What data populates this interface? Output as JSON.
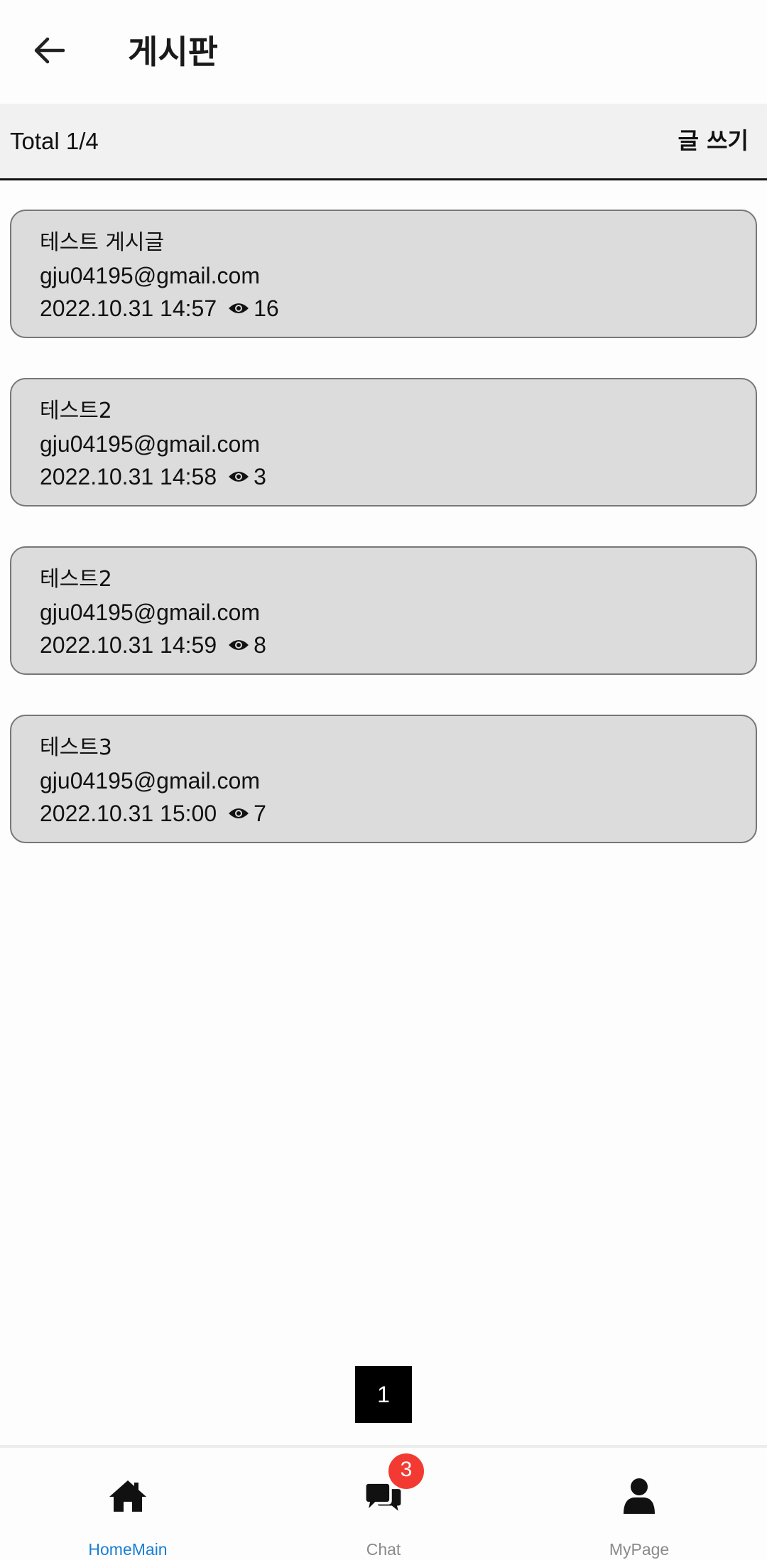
{
  "header": {
    "title": "게시판"
  },
  "subheader": {
    "total": "Total 1/4",
    "write_label": "글 쓰기"
  },
  "posts": [
    {
      "title": "테스트 게시글",
      "author": "gju04195@gmail.com",
      "date": "2022.10.31 14:57",
      "views": "16"
    },
    {
      "title": "테스트2",
      "author": "gju04195@gmail.com",
      "date": "2022.10.31 14:58",
      "views": "3"
    },
    {
      "title": "테스트2",
      "author": "gju04195@gmail.com",
      "date": "2022.10.31 14:59",
      "views": "8"
    },
    {
      "title": "테스트3",
      "author": "gju04195@gmail.com",
      "date": "2022.10.31 15:00",
      "views": "7"
    }
  ],
  "pagination": {
    "current_page": "1"
  },
  "bottom_nav": {
    "items": [
      {
        "label": "HomeMain",
        "icon": "home-icon",
        "active": true
      },
      {
        "label": "Chat",
        "icon": "chat-icon",
        "active": false
      },
      {
        "label": "MyPage",
        "icon": "person-icon",
        "active": false
      }
    ],
    "chat_badge": "3"
  },
  "colors": {
    "active_tab": "#1a7fd4",
    "inactive_tab": "#8a8a8a",
    "badge": "#f23a33",
    "card_background": "#dcdcdc"
  }
}
